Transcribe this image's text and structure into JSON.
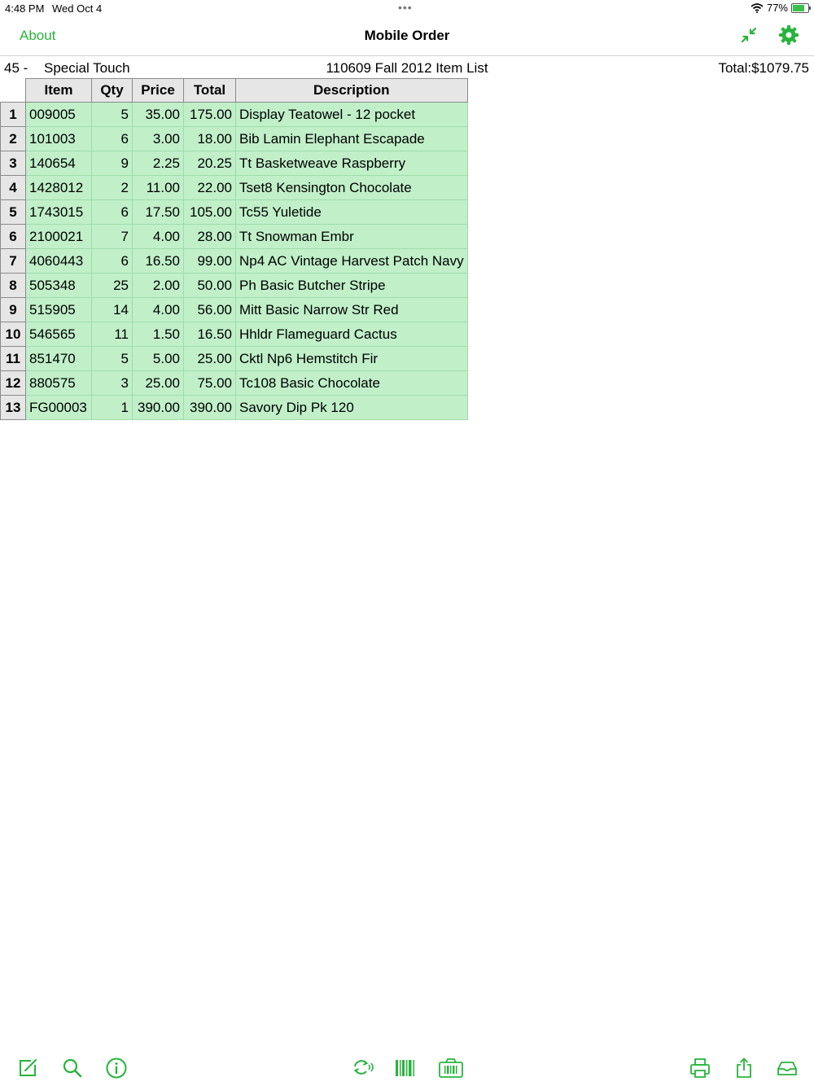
{
  "status_bar": {
    "time": "4:48 PM",
    "date": "Wed Oct 4",
    "battery": "77%",
    "battery_level": 0.77
  },
  "nav": {
    "about_label": "About",
    "title": "Mobile Order"
  },
  "order": {
    "customer_number": "45 -",
    "customer_name": "Special Touch",
    "list_name": "110609 Fall 2012 Item List",
    "total": "Total:$1079.75"
  },
  "table": {
    "columns": [
      "Item",
      "Qty",
      "Price",
      "Total",
      "Description"
    ],
    "rows": [
      [
        "1",
        "009005",
        "5",
        "35.00",
        "175.00",
        "Display Teatowel - 12 pocket"
      ],
      [
        "2",
        "101003",
        "6",
        "3.00",
        "18.00",
        "Bib Lamin Elephant Escapade"
      ],
      [
        "3",
        "140654",
        "9",
        "2.25",
        "20.25",
        "Tt Basketweave Raspberry"
      ],
      [
        "4",
        "1428012",
        "2",
        "11.00",
        "22.00",
        "Tset8 Kensington Chocolate"
      ],
      [
        "5",
        "1743015",
        "6",
        "17.50",
        "105.00",
        "Tc55 Yuletide"
      ],
      [
        "6",
        "2100021",
        "7",
        "4.00",
        "28.00",
        "Tt Snowman Embr"
      ],
      [
        "7",
        "4060443",
        "6",
        "16.50",
        "99.00",
        "Np4 AC Vintage Harvest Patch Navy"
      ],
      [
        "8",
        "505348",
        "25",
        "2.00",
        "50.00",
        "Ph Basic Butcher Stripe"
      ],
      [
        "9",
        "515905",
        "14",
        "4.00",
        "56.00",
        "Mitt Basic Narrow Str Red"
      ],
      [
        "10",
        "546565",
        "11",
        "1.50",
        "16.50",
        "Hhldr Flameguard Cactus"
      ],
      [
        "11",
        "851470",
        "5",
        "5.00",
        "25.00",
        "Cktl Np6 Hemstitch Fir"
      ],
      [
        "12",
        "880575",
        "3",
        "25.00",
        "75.00",
        "Tc108 Basic Chocolate"
      ],
      [
        "13",
        "FG00003",
        "1",
        "390.00",
        "390.00",
        "Savory Dip Pk 120"
      ]
    ]
  },
  "icons": {
    "nav": [
      "collapse-icon",
      "gear-icon"
    ],
    "toolbar": [
      "compose-icon",
      "search-icon",
      "info-icon",
      "sync-icon",
      "barcode-icon",
      "camera-barcode-icon",
      "print-icon",
      "share-icon",
      "inbox-icon"
    ]
  },
  "colors": {
    "accent": "#27b43b",
    "row_bg": "#c0efc8",
    "header_bg": "#e6e6e6"
  }
}
